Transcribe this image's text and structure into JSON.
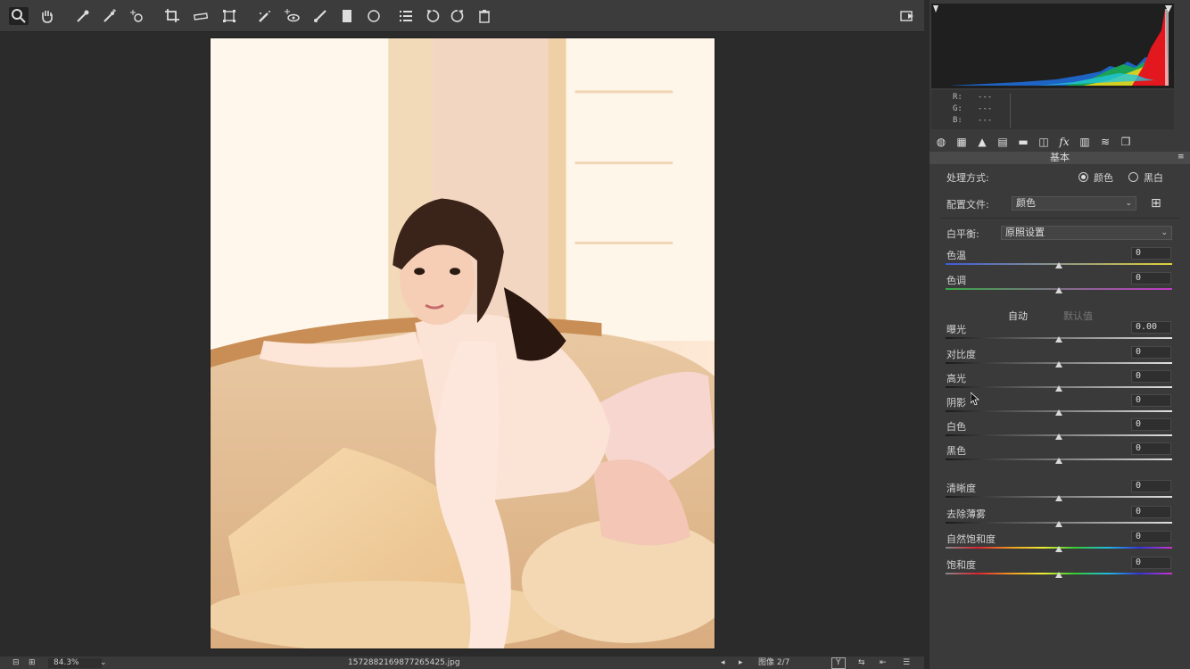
{
  "toolbar": {
    "tools": [
      {
        "name": "zoom-tool",
        "icon": "magnifier-icon",
        "active": true
      },
      {
        "name": "hand-tool",
        "icon": "hand-icon"
      },
      {
        "name": "white-balance-tool",
        "icon": "eyedropper-icon"
      },
      {
        "name": "color-sampler-tool",
        "icon": "eyedropper-plus-icon"
      },
      {
        "name": "targeted-adjustment-tool",
        "icon": "target-adjust-icon"
      },
      {
        "name": "crop-tool",
        "icon": "crop-icon"
      },
      {
        "name": "straighten-tool",
        "icon": "straighten-icon"
      },
      {
        "name": "transform-tool",
        "icon": "transform-icon"
      },
      {
        "name": "spot-removal-tool",
        "icon": "spot-removal-icon"
      },
      {
        "name": "red-eye-tool",
        "icon": "red-eye-icon"
      },
      {
        "name": "adjustment-brush-tool",
        "icon": "brush-icon"
      },
      {
        "name": "graduated-filter-tool",
        "icon": "graduated-filter-icon"
      },
      {
        "name": "radial-filter-tool",
        "icon": "radial-filter-icon"
      },
      {
        "name": "preferences-tool",
        "icon": "list-icon"
      },
      {
        "name": "rotate-left-tool",
        "icon": "rotate-left-icon"
      },
      {
        "name": "rotate-right-tool",
        "icon": "rotate-right-icon"
      },
      {
        "name": "delete-tool",
        "icon": "trash-icon"
      },
      {
        "name": "fullscreen-toggle",
        "icon": "fullscreen-exit-icon"
      }
    ]
  },
  "status": {
    "zoom": "84.3%",
    "filename": "1572882169877265425.jpg",
    "image_counter": "图像 2/7"
  },
  "readout": {
    "r_label": "R:",
    "r_value": "---",
    "g_label": "G:",
    "g_value": "---",
    "b_label": "B:",
    "b_value": "---"
  },
  "panel": {
    "title": "基本",
    "treatment_label": "处理方式:",
    "treatment_color": "颜色",
    "treatment_bw": "黑白",
    "profile_label": "配置文件:",
    "profile_value": "颜色",
    "wb_label": "白平衡:",
    "wb_value": "原照设置",
    "auto_label": "自动",
    "default_label": "默认值",
    "sliders": [
      {
        "key": "temp",
        "label": "色温",
        "value": "0",
        "position": 0.5
      },
      {
        "key": "tint",
        "label": "色调",
        "value": "0",
        "position": 0.5
      },
      {
        "key": "exposure",
        "label": "曝光",
        "value": "0.00",
        "position": 0.5
      },
      {
        "key": "contrast",
        "label": "对比度",
        "value": "0",
        "position": 0.5
      },
      {
        "key": "highlights",
        "label": "高光",
        "value": "0",
        "position": 0.5
      },
      {
        "key": "shadows",
        "label": "阴影",
        "value": "0",
        "position": 0.5
      },
      {
        "key": "whites",
        "label": "白色",
        "value": "0",
        "position": 0.5
      },
      {
        "key": "blacks",
        "label": "黑色",
        "value": "0",
        "position": 0.5
      },
      {
        "key": "clarity",
        "label": "清晰度",
        "value": "0",
        "position": 0.5
      },
      {
        "key": "dehaze",
        "label": "去除薄雾",
        "value": "0",
        "position": 0.5
      },
      {
        "key": "vibrance",
        "label": "自然饱和度",
        "value": "0",
        "position": 0.5
      },
      {
        "key": "saturation",
        "label": "饱和度",
        "value": "0",
        "position": 0.5
      }
    ]
  },
  "colors": {
    "panel_bg": "#3a3a3a",
    "canvas_bg": "#2b2b2b",
    "temp_gradient_start": "#3d5bd8",
    "temp_gradient_end": "#e0d23a",
    "tint_gradient_start": "#3aa845",
    "tint_gradient_end": "#c23ac7"
  }
}
